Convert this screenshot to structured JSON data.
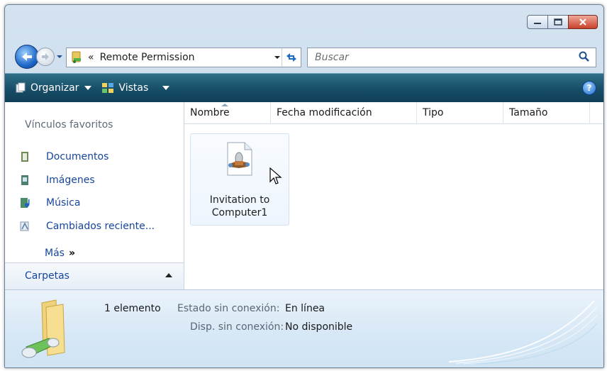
{
  "address": {
    "chevron": "«",
    "path": "Remote Permission"
  },
  "search": {
    "placeholder": "Buscar"
  },
  "toolbar": {
    "organize_label": "Organizar",
    "views_label": "Vistas",
    "help_label": "?"
  },
  "favorites": {
    "title": "Vínculos favoritos",
    "items": [
      {
        "label": "Documentos",
        "icon": "documents-icon"
      },
      {
        "label": "Imágenes",
        "icon": "pictures-icon"
      },
      {
        "label": "Música",
        "icon": "music-icon"
      },
      {
        "label": "Cambiados reciente...",
        "icon": "recent-changes-icon"
      }
    ],
    "more_label": "Más",
    "more_glyph": "»"
  },
  "folders": {
    "label": "Carpetas"
  },
  "columns": [
    "Nombre",
    "Fecha modificación",
    "Tipo",
    "Tamaño"
  ],
  "files": [
    {
      "name_line1": "Invitation to",
      "name_line2": "Computer1"
    }
  ],
  "details": {
    "count": "1 elemento",
    "offline_status_label": "Estado sin conexión:",
    "offline_status_value": "En línea",
    "offline_avail_label": "Disp. sin conexión:",
    "offline_avail_value": "No disponible"
  },
  "colors": {
    "toolbar": "#174d67",
    "link": "#16459c",
    "close_button": "#c8412a"
  }
}
